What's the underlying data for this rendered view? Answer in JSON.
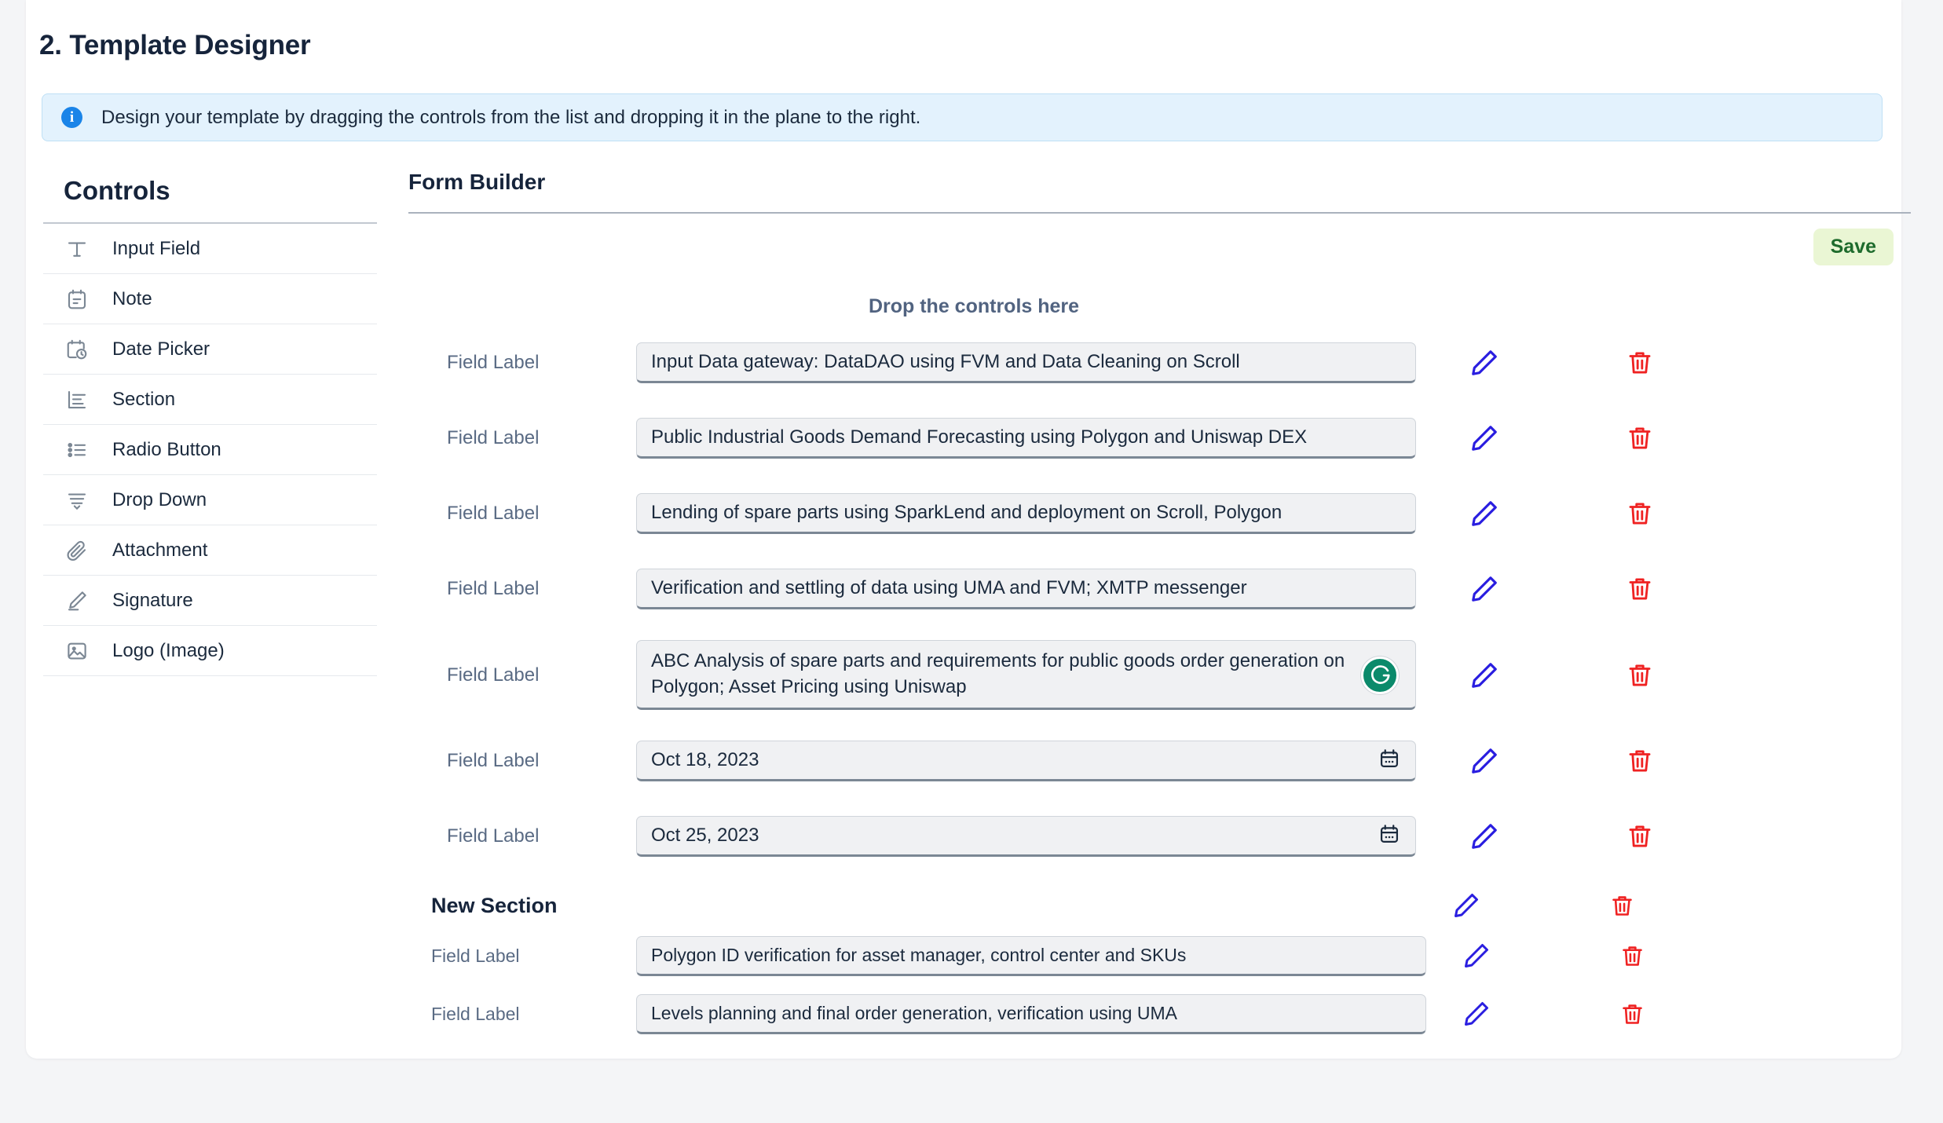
{
  "page": {
    "title": "2. Template Designer",
    "info_banner": {
      "icon": "info-icon",
      "text": "Design your template by dragging the controls from the list and dropping it in the plane to the right."
    }
  },
  "controls": {
    "heading": "Controls",
    "items": [
      {
        "label": "Input Field",
        "icon": "text-t-icon"
      },
      {
        "label": "Note",
        "icon": "note-icon"
      },
      {
        "label": "Date Picker",
        "icon": "date-picker-icon"
      },
      {
        "label": "Section",
        "icon": "section-icon"
      },
      {
        "label": "Radio Button",
        "icon": "radio-list-icon"
      },
      {
        "label": "Drop Down",
        "icon": "drop-down-icon"
      },
      {
        "label": "Attachment",
        "icon": "paperclip-icon"
      },
      {
        "label": "Signature",
        "icon": "signature-pen-icon"
      },
      {
        "label": "Logo (Image)",
        "icon": "image-icon"
      }
    ]
  },
  "builder": {
    "title": "Form Builder",
    "save_label": "Save",
    "drop_hint": "Drop the controls here",
    "rows": [
      {
        "label": "Field Label",
        "value": "Input Data gateway: DataDAO using FVM and Data Cleaning on Scroll",
        "type": "text"
      },
      {
        "label": "Field Label",
        "value": "Public Industrial Goods Demand Forecasting using Polygon and Uniswap DEX",
        "type": "text"
      },
      {
        "label": "Field Label",
        "value": "Lending of spare parts using SparkLend and deployment on Scroll, Polygon",
        "type": "text"
      },
      {
        "label": "Field Label",
        "value": "Verification and settling of data using UMA and FVM; XMTP messenger",
        "type": "text"
      },
      {
        "label": "Field Label",
        "value": "ABC Analysis of spare parts and requirements for public goods order generation on Polygon; Asset Pricing using Uniswap",
        "type": "textarea",
        "badge": "grammarly-icon"
      },
      {
        "label": "Field Label",
        "value": "Oct 18, 2023",
        "type": "date"
      },
      {
        "label": "Field Label",
        "value": "Oct 25, 2023",
        "type": "date"
      }
    ],
    "section": {
      "title": "New Section",
      "rows": [
        {
          "label": "Field Label",
          "value": "Polygon ID verification for asset manager, control center and SKUs"
        },
        {
          "label": "Field Label",
          "value": "Levels planning and final order generation, verification using UMA"
        }
      ]
    }
  },
  "colors": {
    "accent_edit": "#2a1ee0",
    "accent_delete": "#ef2222",
    "save_bg": "#eaf6d4",
    "save_text": "#1e6b2c",
    "info_bg": "#e3f2fd",
    "grammarly": "#0b8a6b"
  }
}
